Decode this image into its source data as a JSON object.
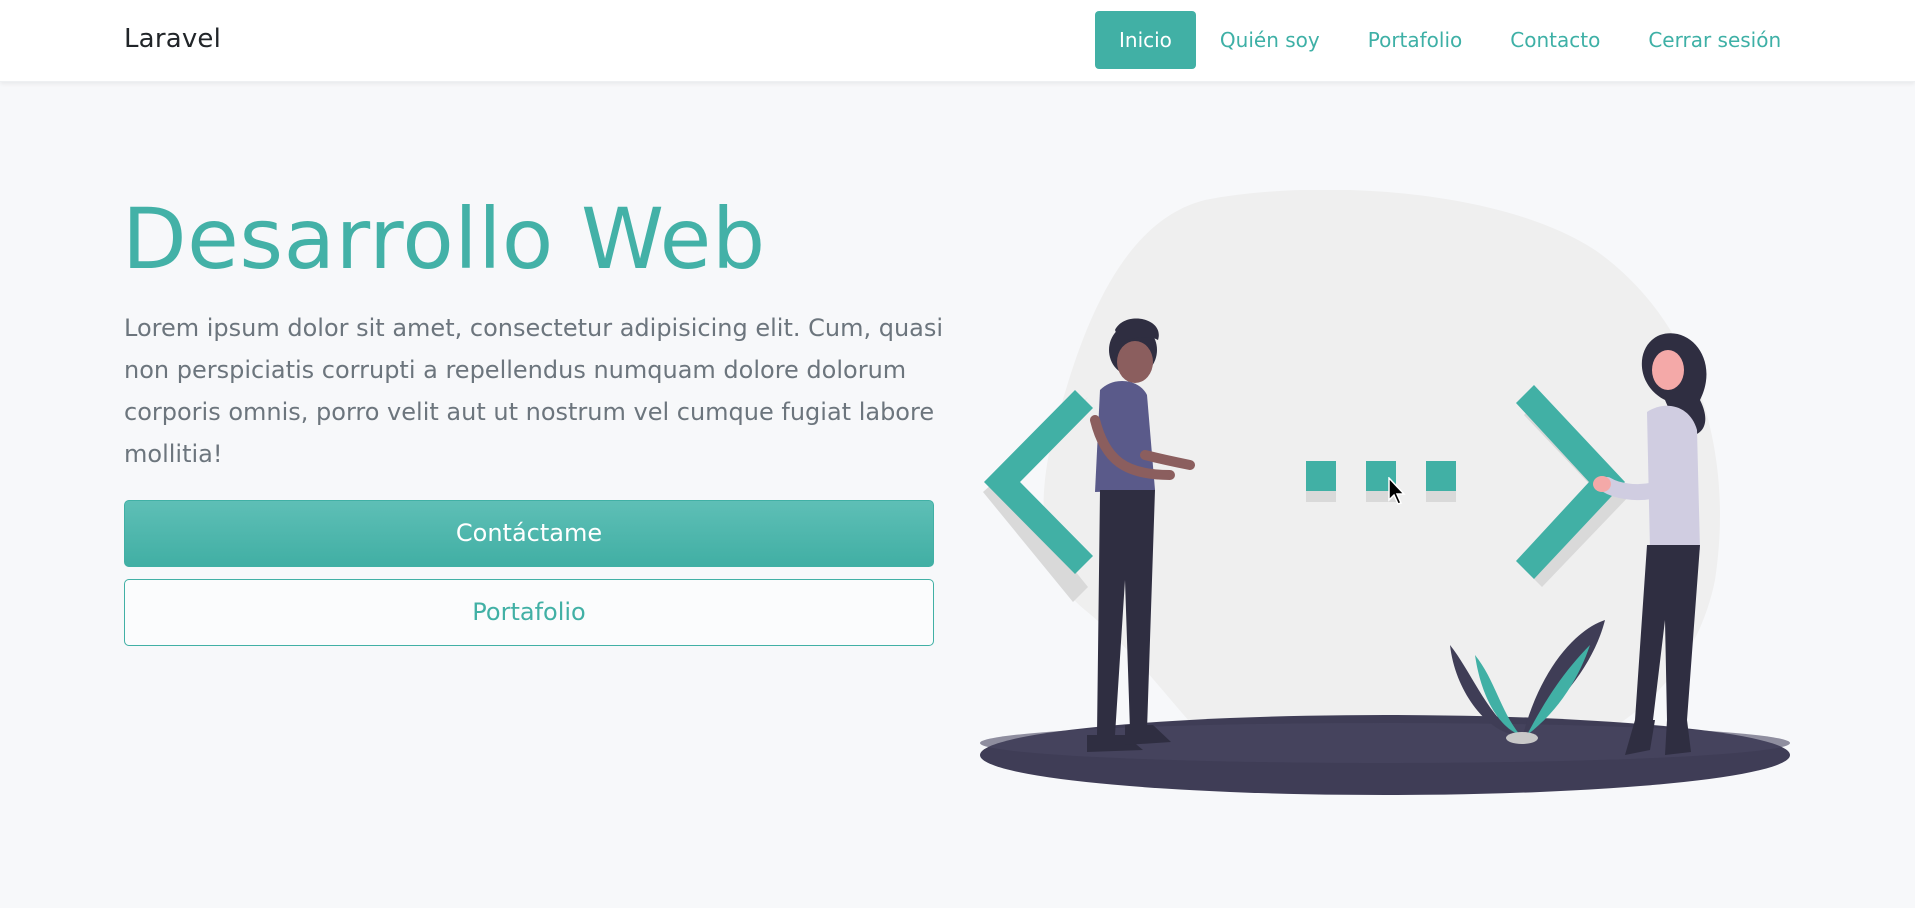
{
  "navbar": {
    "brand": "Laravel",
    "links": [
      {
        "label": "Inicio",
        "active": true
      },
      {
        "label": "Quién soy",
        "active": false
      },
      {
        "label": "Portafolio",
        "active": false
      },
      {
        "label": "Contacto",
        "active": false
      },
      {
        "label": "Cerrar sesión",
        "active": false
      }
    ]
  },
  "hero": {
    "title": "Desarrollo Web",
    "text": "Lorem ipsum dolor sit amet, consectetur adipisicing elit. Cum, quasi non perspiciatis corrupti a repellendus numquam dolore dolorum corporis omnis, porro velit aut ut nostrum vel cumque fugiat labore mollitia!",
    "primary_button": "Contáctame",
    "secondary_button": "Portafolio"
  },
  "illustration": {
    "name": "web-development-illustration-icon"
  },
  "colors": {
    "accent": "#41b0a5",
    "text_muted": "#6c757d",
    "background": "#f7f8fa",
    "dark": "#3f3d56"
  }
}
